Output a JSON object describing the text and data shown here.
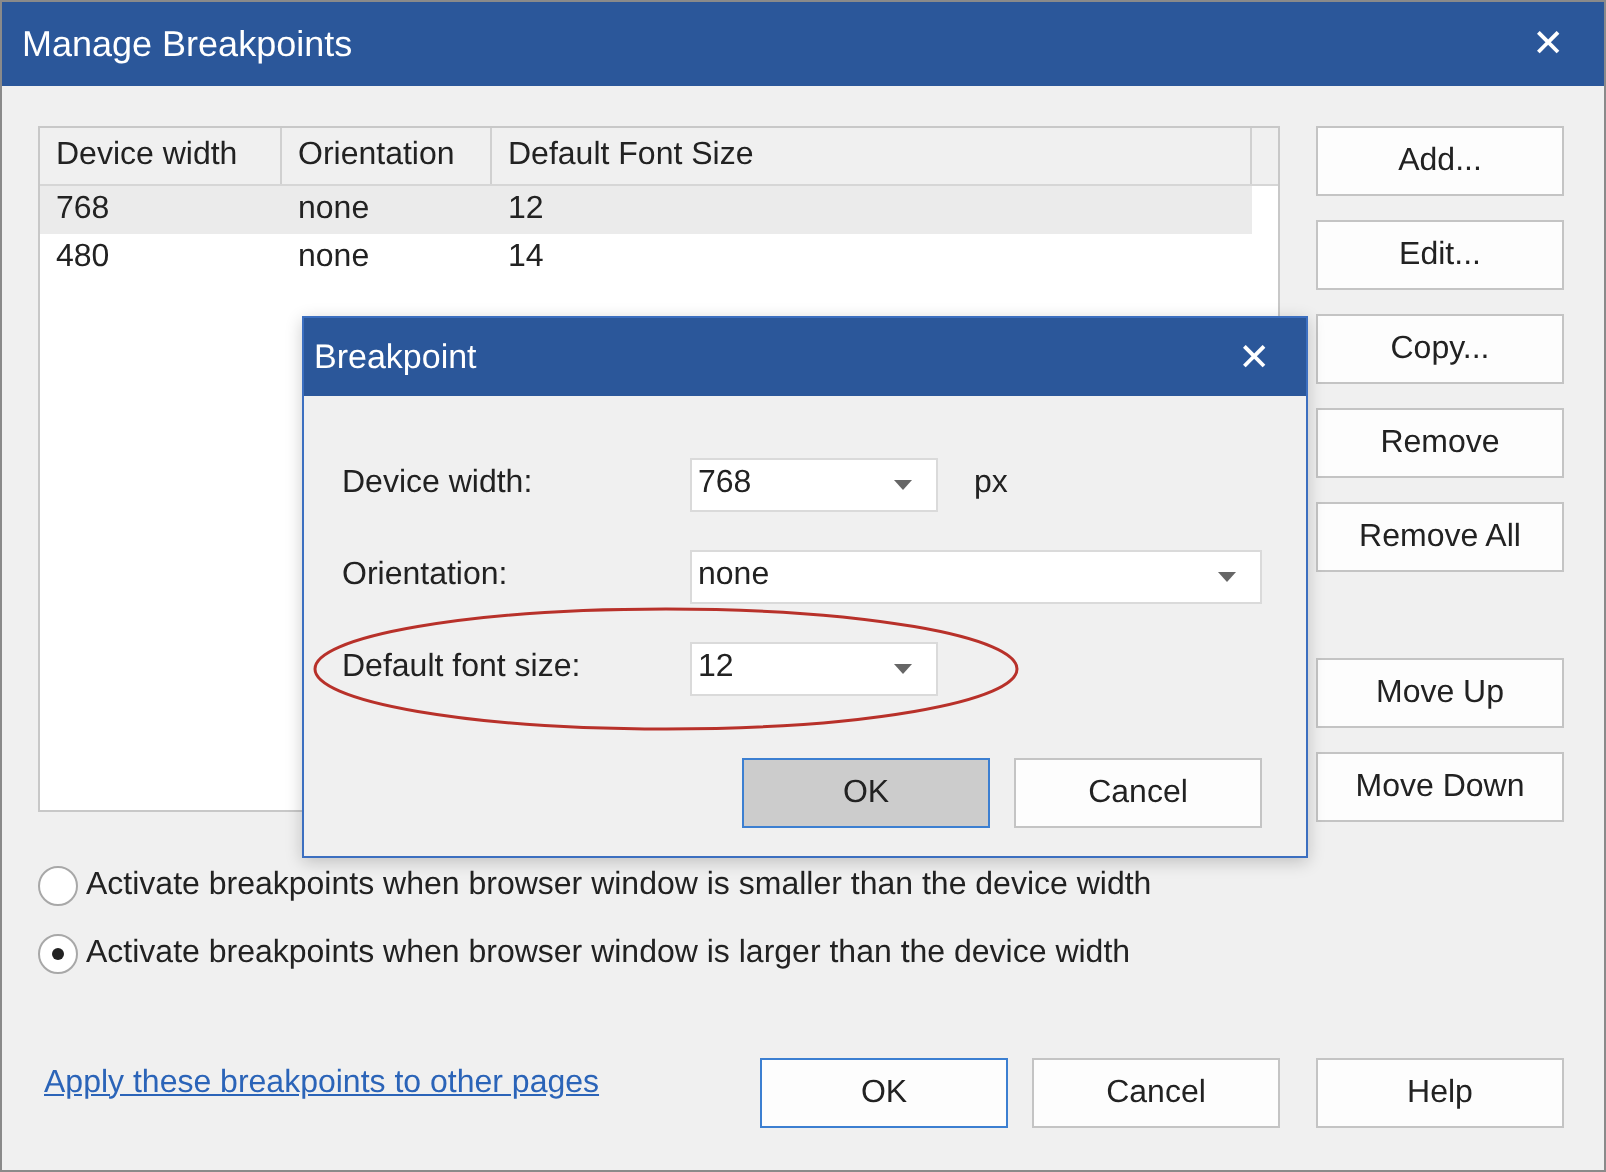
{
  "window": {
    "title": "Manage Breakpoints",
    "close": "✕"
  },
  "table": {
    "columns": [
      "Device width",
      "Orientation",
      "Default Font Size"
    ],
    "rows": [
      {
        "cells": [
          "768",
          "none",
          "12"
        ],
        "selected": true
      },
      {
        "cells": [
          "480",
          "none",
          "14"
        ],
        "selected": false
      }
    ]
  },
  "side_buttons": [
    {
      "label": "Add...",
      "kind": "top"
    },
    {
      "label": "Edit...",
      "kind": "top"
    },
    {
      "label": "Copy...",
      "kind": "top"
    },
    {
      "label": "Remove",
      "kind": "top"
    },
    {
      "label": "Remove All",
      "kind": "top"
    },
    {
      "label": "Move Up",
      "kind": "bottom"
    },
    {
      "label": "Move Down",
      "kind": "bottom"
    }
  ],
  "radios": [
    {
      "label": "Activate breakpoints when browser window is smaller than the device width",
      "selected": false
    },
    {
      "label": "Activate breakpoints when browser window is larger than the device width",
      "selected": true
    }
  ],
  "link": "Apply these breakpoints to other pages",
  "buttons": [
    {
      "label": "OK",
      "default": true
    },
    {
      "label": "Cancel",
      "default": false
    },
    {
      "label": "Help",
      "default": false
    }
  ],
  "dialog": {
    "title": "Breakpoint",
    "close": "✕",
    "fields": [
      {
        "label": "Device width:",
        "value": "768",
        "unit": "px",
        "kind": "short",
        "circled": false
      },
      {
        "label": "Orientation:",
        "value": "none",
        "kind": "wide",
        "circled": false
      },
      {
        "label": "Default font size:",
        "value": "12",
        "kind": "short",
        "circled": true
      }
    ],
    "buttons": [
      {
        "label": "OK",
        "pressed": true
      },
      {
        "label": "Cancel",
        "pressed": false
      }
    ]
  }
}
